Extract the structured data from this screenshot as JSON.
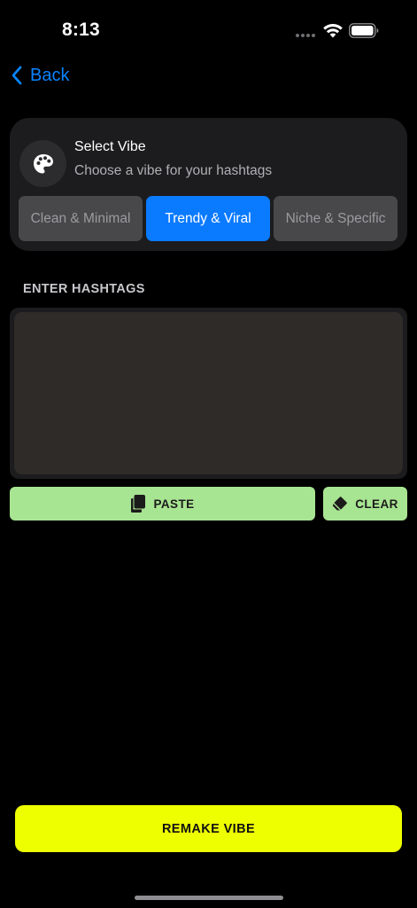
{
  "status_bar": {
    "time": "8:13",
    "icons": [
      "signal-dots-icon",
      "wifi-icon",
      "battery-icon"
    ]
  },
  "nav": {
    "back_label": "Back",
    "back_icon": "chevron-left-icon"
  },
  "vibe_card": {
    "icon": "palette-icon",
    "title": "Select Vibe",
    "subtitle": "Choose a vibe for your hashtags",
    "options": [
      {
        "label": "Clean & Minimal",
        "selected": false
      },
      {
        "label": "Trendy & Viral",
        "selected": true
      },
      {
        "label": "Niche & Specific",
        "selected": false
      }
    ]
  },
  "hashtags": {
    "section_label": "ENTER HASHTAGS",
    "value": "",
    "placeholder": ""
  },
  "actions": {
    "paste_label": "PASTE",
    "paste_icon": "clipboard-icon",
    "clear_label": "CLEAR",
    "clear_icon": "eraser-icon"
  },
  "remake_label": "REMAKE VIBE",
  "colors": {
    "background": "#000000",
    "card": "#1c1c1e",
    "accent_blue": "#0a7aff",
    "action_green": "#a8e592",
    "remake_yellow": "#eeff00",
    "option_inactive": "#48484a"
  }
}
